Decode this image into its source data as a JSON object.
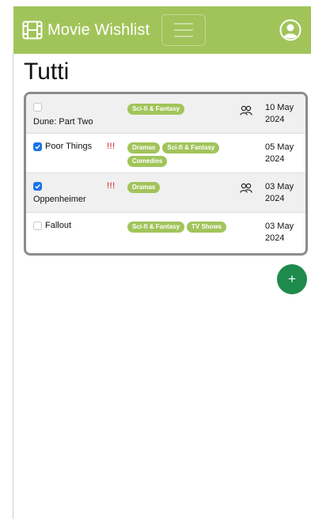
{
  "navbar": {
    "brand_title": "Movie Wishlist",
    "brand_icon": "film-icon",
    "menu_icon": "hamburger-icon",
    "user_icon": "user-circle-icon",
    "accent_color": "#a1c45a"
  },
  "page": {
    "title": "Tutti"
  },
  "list": {
    "items": [
      {
        "title": "Dune: Part Two",
        "checked": false,
        "priority": "",
        "tags": [
          "Sci-fi & Fantasy"
        ],
        "shared": true,
        "date_line1": "10 May",
        "date_line2": "2024"
      },
      {
        "title": "Poor Things",
        "checked": true,
        "priority": "!!!",
        "tags": [
          "Dramas",
          "Sci-fi & Fantasy",
          "Comedies"
        ],
        "shared": false,
        "date_line1": "05 May",
        "date_line2": "2024"
      },
      {
        "title": "Oppenheimer",
        "checked": true,
        "priority": "!!!",
        "tags": [
          "Dramas"
        ],
        "shared": true,
        "date_line1": "03 May",
        "date_line2": "2024"
      },
      {
        "title": "Fallout",
        "checked": false,
        "priority": "",
        "tags": [
          "Sci-fi & Fantasy",
          "TV Shows"
        ],
        "shared": false,
        "date_line1": "03 May",
        "date_line2": "2024"
      }
    ]
  },
  "fab": {
    "label": "+",
    "color": "#1e8a4c"
  }
}
